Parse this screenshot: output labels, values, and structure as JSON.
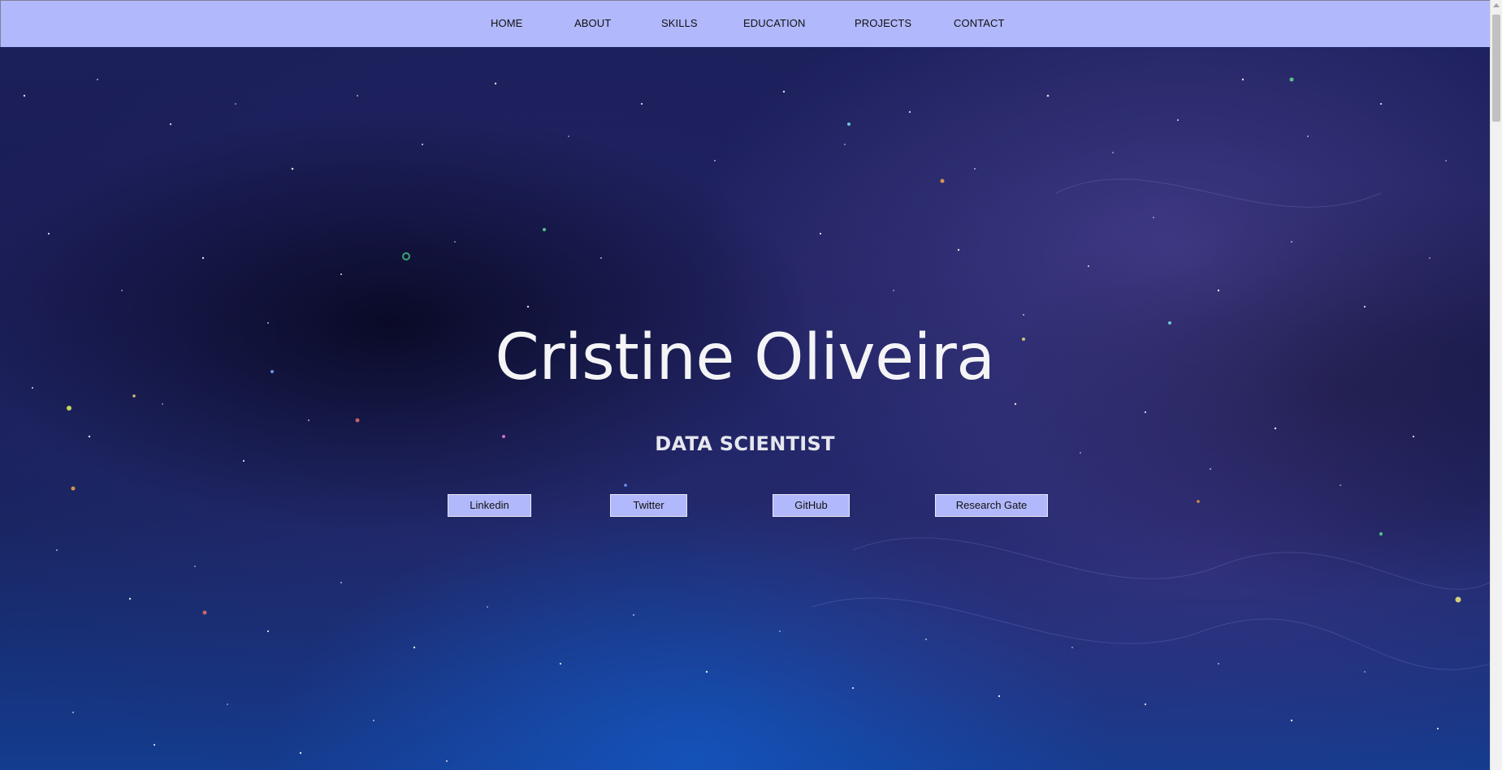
{
  "navbar": {
    "items": [
      {
        "label": "HOME"
      },
      {
        "label": "ABOUT"
      },
      {
        "label": "SKILLS"
      },
      {
        "label": "EDUCATION"
      },
      {
        "label": "PROJECTS"
      },
      {
        "label": "CONTACT"
      }
    ]
  },
  "hero": {
    "name": "Cristine Oliveira",
    "title": "DATA SCIENTIST"
  },
  "social_links": [
    {
      "label": "Linkedin"
    },
    {
      "label": "Twitter"
    },
    {
      "label": "GitHub"
    },
    {
      "label": "Research Gate"
    }
  ],
  "colors": {
    "navbar_bg": "#b1b8fb",
    "button_bg": "#b1b8fb",
    "title_text": "#f4f4f6",
    "space_dark": "#1a1c55",
    "space_blue": "#143c8f"
  }
}
